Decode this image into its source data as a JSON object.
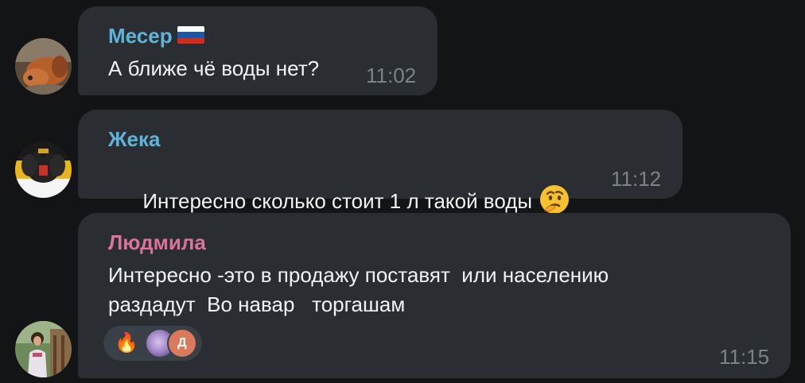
{
  "messages": [
    {
      "sender": "Месер",
      "sender_color": "#5fb3d9",
      "flag": "ru-flag",
      "text": "А ближе чё воды нет?",
      "time": "11:02",
      "avatar": "dog-avatar"
    },
    {
      "sender": "Жека",
      "sender_color": "#5fb3d9",
      "text": "Интересно сколько стоит 1 л такой воды",
      "emoji": "thinking-face-emoji",
      "time": "11:12",
      "avatar": "double-eagle-avatar"
    },
    {
      "sender": "Людмила",
      "sender_color": "#d9739a",
      "text_lines": [
        "Интересно -это в продажу поставят  или населению",
        "раздадут  Во навар   торгашам"
      ],
      "time": "11:15",
      "avatar": "woman-avatar",
      "reaction": {
        "emoji": "🔥",
        "reactor_initial": "Д"
      }
    }
  ]
}
